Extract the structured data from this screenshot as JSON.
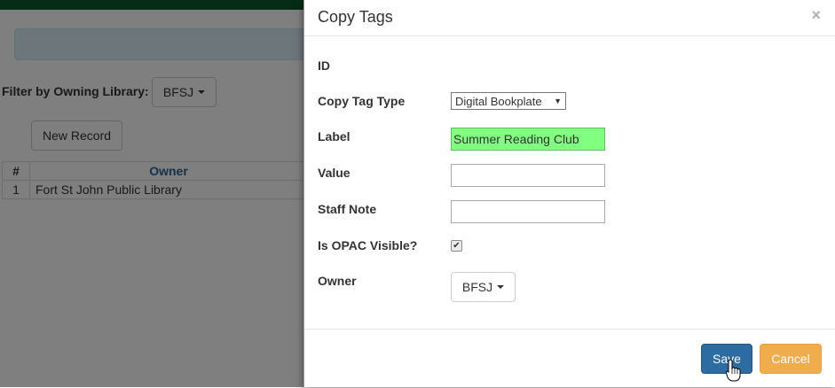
{
  "background": {
    "filter_label": "Filter by Owning Library:",
    "filter_value": "BFSJ",
    "new_record_label": "New Record",
    "table": {
      "headers": [
        "#",
        "Owner"
      ],
      "rows": [
        [
          "1",
          "Fort St John Public Library"
        ]
      ]
    }
  },
  "modal": {
    "title": "Copy Tags",
    "close_glyph": "×",
    "fields": {
      "id_label": "ID",
      "type_label": "Copy Tag Type",
      "type_value": "Digital Bookplate",
      "label_label": "Label",
      "label_value": "Summer Reading Club",
      "value_label": "Value",
      "value_value": "",
      "staff_note_label": "Staff Note",
      "staff_note_value": "",
      "opac_label": "Is OPAC Visible?",
      "opac_checked": true,
      "owner_label": "Owner",
      "owner_value": "BFSJ"
    },
    "footer": {
      "save_label": "Save",
      "cancel_label": "Cancel"
    }
  },
  "colors": {
    "top_bar": "#0b5a2c",
    "primary": "#2d6ca2",
    "warning": "#f0ad4e",
    "label_highlight": "#80ff80"
  },
  "icons": {
    "caret": "caret-down-icon",
    "checkmark": "checkmark-icon",
    "cursor": "hand-pointer-icon"
  }
}
